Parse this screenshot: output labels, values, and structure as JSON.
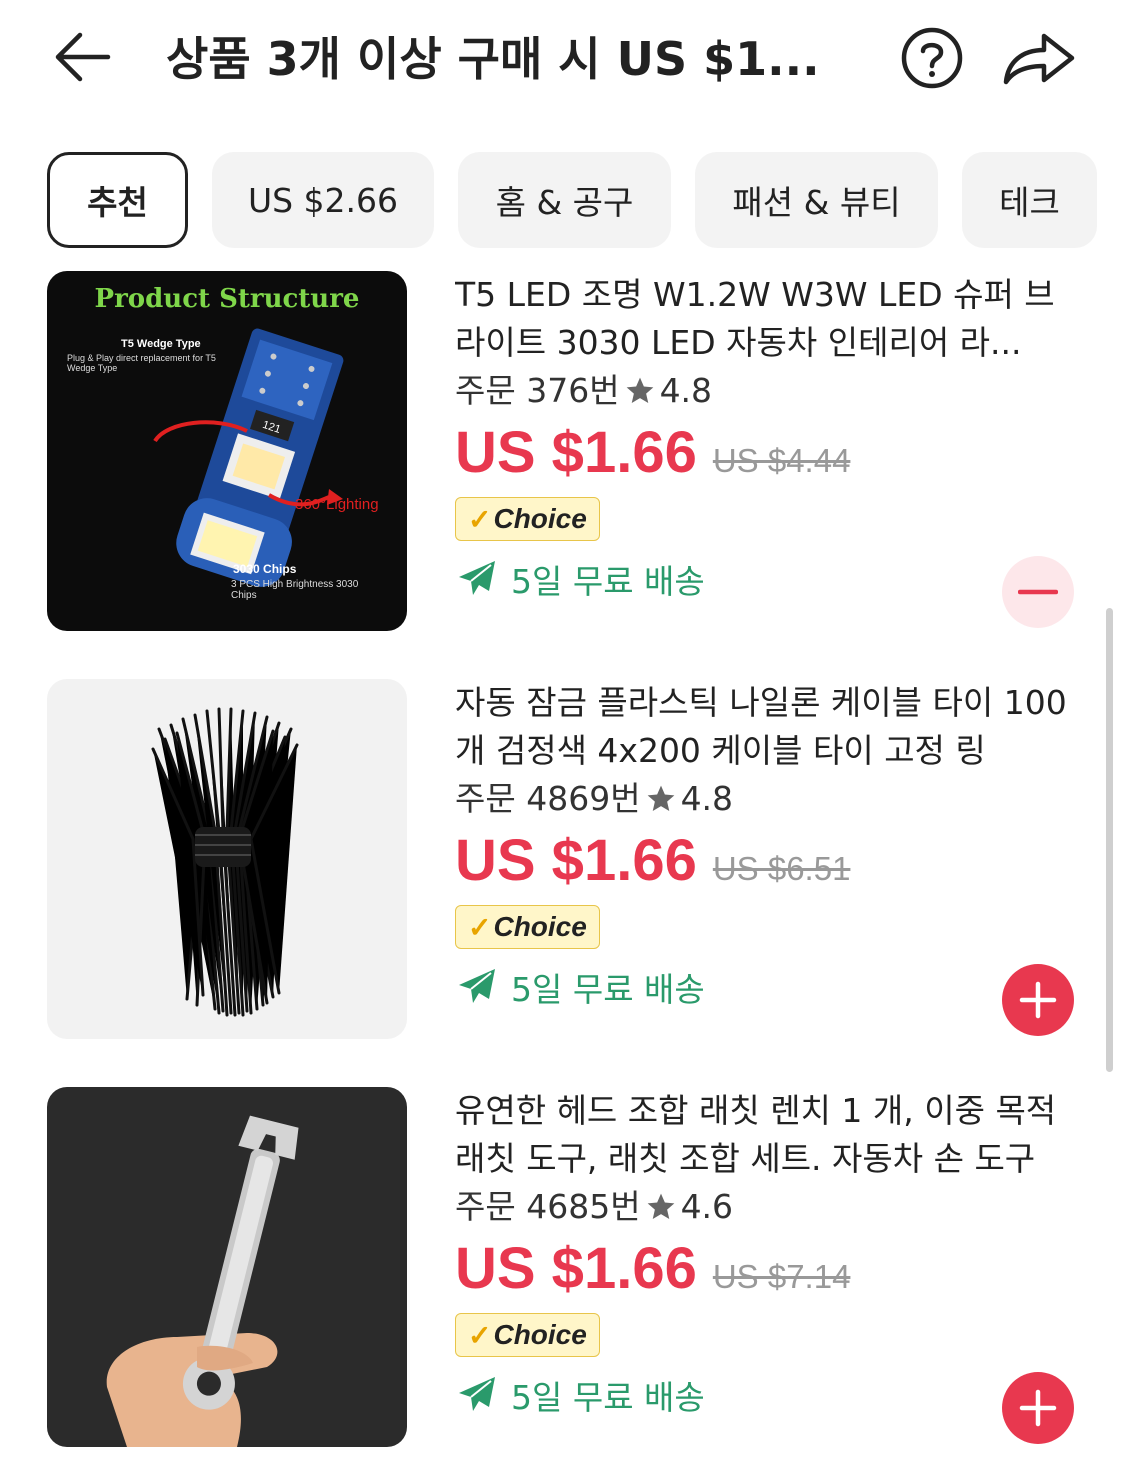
{
  "header": {
    "title": "상품 3개 이상 구매 시 US $1...",
    "back_icon": "arrow-left-icon",
    "help_icon": "question-circle-icon",
    "share_icon": "share-arrow-icon"
  },
  "tabs": [
    {
      "label": "추천",
      "active": true
    },
    {
      "label": "US $2.66",
      "active": false
    },
    {
      "label": "홈 & 공구",
      "active": false
    },
    {
      "label": "패션 & 뷰티",
      "active": false
    },
    {
      "label": "테크",
      "active": false
    }
  ],
  "products": [
    {
      "title": "T5 LED 조명 W1.2W W3W LED 슈퍼 브라이트 3030 LED 자동차 인테리어 라...",
      "orders": "주문 376번",
      "rating": "4.8",
      "price": "US $1.66",
      "old_price": "US $4.44",
      "badge": "Choice",
      "shipping": "5일 무료 배송",
      "action": "remove",
      "image": {
        "heading": "Product Structure",
        "label_type": "T5 Wedge Type",
        "label_plug": "Plug & Play direct replacement for T5 Wedge Type",
        "label_lighting": "360°Lighting",
        "label_chips": "3030 Chips",
        "label_chips_sub": "3 PCS High Brightness 3030 Chips",
        "chip_marking": "121"
      }
    },
    {
      "title": "자동 잠금 플라스틱 나일론 케이블 타이 100 개 검정색 4x200 케이블 타이 고정 링",
      "orders": "주문 4869번",
      "rating": "4.8",
      "price": "US $1.66",
      "old_price": "US $6.51",
      "badge": "Choice",
      "shipping": "5일 무료 배송",
      "action": "add"
    },
    {
      "title": "유연한 헤드 조합 래칫 렌치 1 개, 이중 목적 래칫 도구, 래칫 조합 세트. 자동차 손 도구",
      "orders": "주문 4685번",
      "rating": "4.6",
      "price": "US $1.66",
      "old_price": "US $7.14",
      "badge": "Choice",
      "shipping": "5일 무료 배송",
      "action": "add"
    }
  ],
  "colors": {
    "price": "#e8384f",
    "shipping": "#2a9a6b",
    "choice_bg": "#fff6c9"
  }
}
